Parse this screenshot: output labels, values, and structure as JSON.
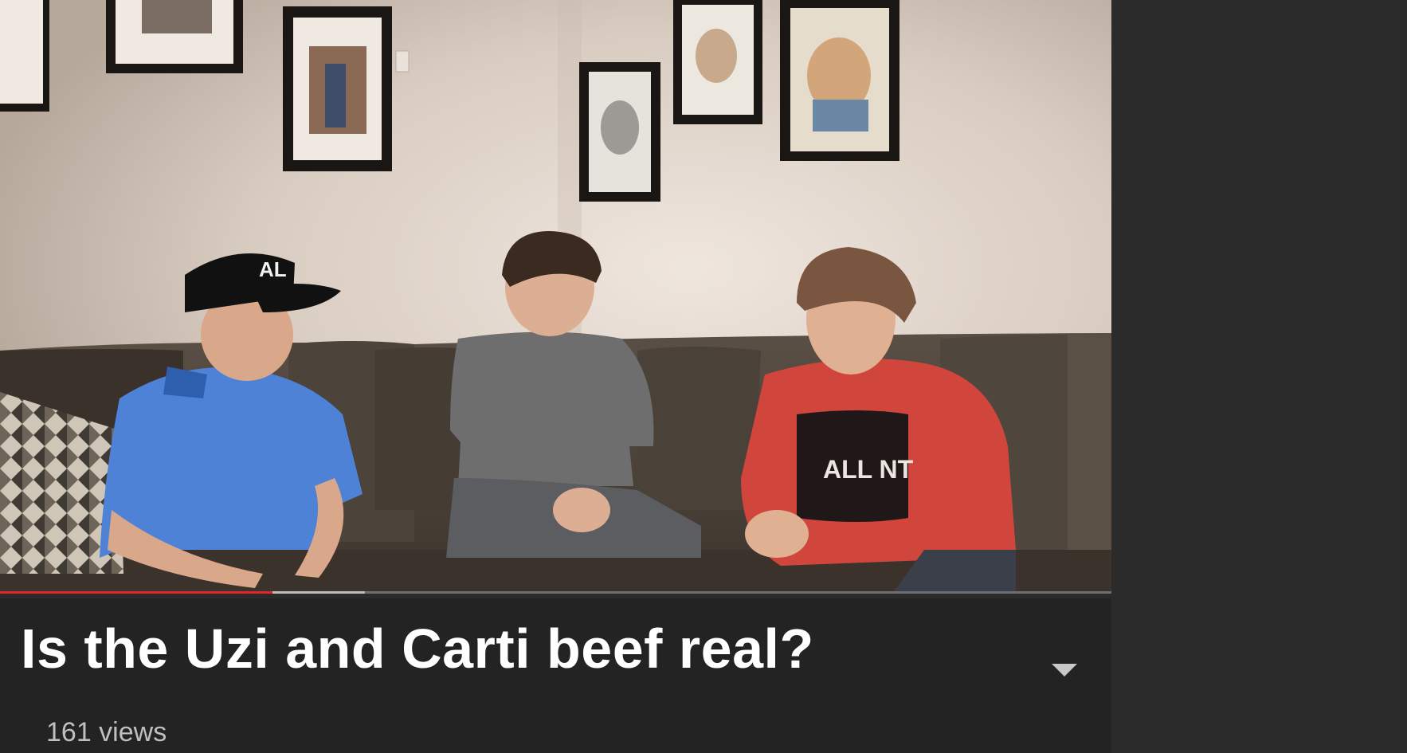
{
  "video": {
    "title": "Is the Uzi and Carti beef real?",
    "views": "161 views",
    "progress": {
      "played_fraction": 0.245,
      "buffered_fraction": 0.328
    }
  },
  "cap_text": "AL",
  "shirt_text": "ALL NT",
  "icons": {
    "expand": "chevron-down-icon"
  },
  "colors": {
    "progress_played": "#e3262b",
    "progress_buffered": "#bdbdbd",
    "info_background": "#232323",
    "page_background": "#2b2b2b"
  }
}
